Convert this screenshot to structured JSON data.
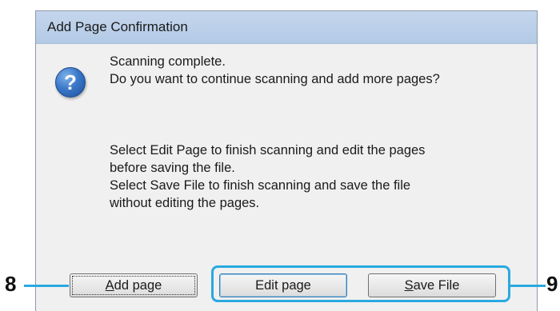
{
  "dialog": {
    "title": "Add Page Confirmation",
    "icon": "question-icon",
    "message_lines": [
      "Scanning complete.",
      "Do you want to continue scanning and add more pages?"
    ],
    "info_lines": [
      "Select Edit Page to finish scanning and edit the pages",
      "before saving the file.",
      "Select Save File to finish scanning and save the file",
      "without editing the pages."
    ],
    "buttons": {
      "add_page": {
        "label": "Add page",
        "mnemonic": "A",
        "rest": "dd page"
      },
      "edit_page": {
        "label": "Edit page"
      },
      "save_file": {
        "label": "Save File",
        "mnemonic": "S",
        "rest": "ave File"
      }
    }
  },
  "callouts": {
    "left_number": "8",
    "right_number": "9",
    "accent_color": "#29a9e0"
  }
}
